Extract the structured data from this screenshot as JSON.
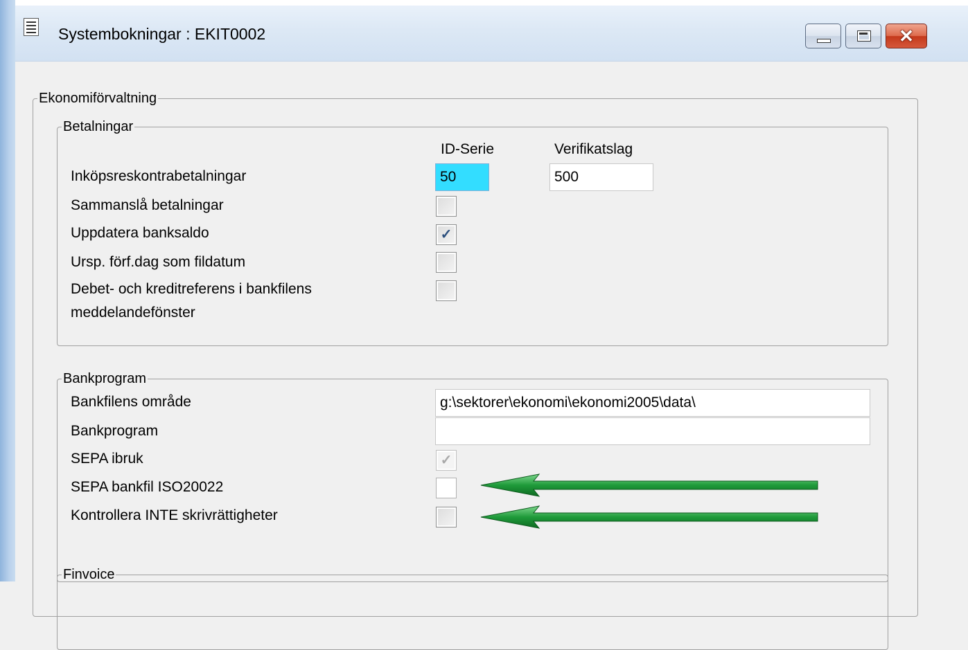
{
  "window": {
    "title": "Systembokningar : EKIT0002",
    "icon": "document-icon",
    "minimize_glyph": "",
    "maximize_glyph": "",
    "close_glyph": "✕"
  },
  "ekonomi": {
    "legend": "Ekonomiförvaltning",
    "betalningar": {
      "legend": "Betalningar",
      "col_id_serie": "ID-Serie",
      "col_verifikatslag": "Verifikatslag",
      "inkop_label": "Inköpsreskontrabetalningar",
      "inkop_id_serie": "50",
      "inkop_verifikatslag": "500",
      "samman_label": "Sammanslå betalningar",
      "samman_checked": false,
      "uppdatera_label": "Uppdatera banksaldo",
      "uppdatera_checked": true,
      "ursp_label": "Ursp. förf.dag som fildatum",
      "ursp_checked": false,
      "debet_label": "Debet- och kreditreferens i bankfilens meddelandefönster",
      "debet_checked": false
    },
    "bankprogram": {
      "legend": "Bankprogram",
      "omrade_label": "Bankfilens område",
      "omrade_value": "g:\\sektorer\\ekonomi\\ekonomi2005\\data\\",
      "program_label": "Bankprogram",
      "program_value": "",
      "sepa_label": "SEPA ibruk",
      "sepa_checked": true,
      "sepa_iso_label": "SEPA bankfil ISO20022",
      "sepa_iso_checked": false,
      "kontroll_label": "Kontrollera INTE skrivrättigheter",
      "kontroll_checked": false
    },
    "finvoice": {
      "legend": "Finvoice"
    }
  },
  "check_glyph": "✓",
  "annotation": {
    "arrow_color": "#1f9a3a"
  }
}
